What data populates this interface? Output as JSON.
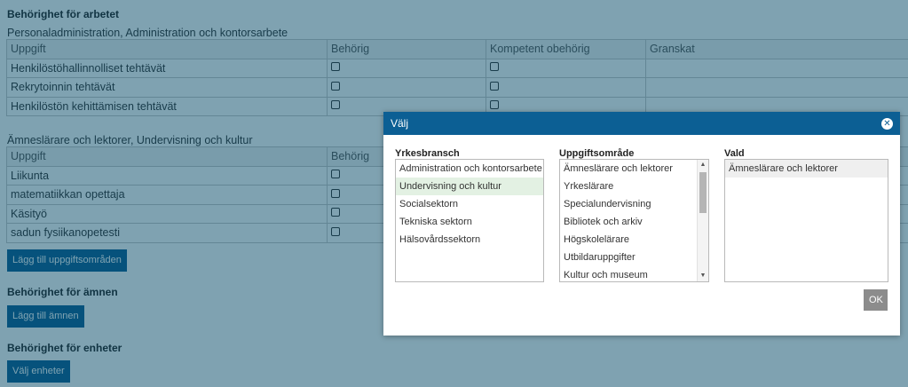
{
  "section1": {
    "heading": "Behörighet för arbetet",
    "subheading": "Personaladministration, Administration och kontorsarbete",
    "columns": [
      "Uppgift",
      "Behörig",
      "Kompetent obehörig",
      "Granskat"
    ],
    "rows": [
      "Henkilöstöhallinnolliset tehtävät",
      "Rekrytoinnin tehtävät",
      "Henkilöstön kehittämisen tehtävät"
    ]
  },
  "section2": {
    "subheading": "Ämneslärare och lektorer, Undervisning och kultur",
    "columns": [
      "Uppgift",
      "Behörig"
    ],
    "rows": [
      "Liikunta",
      "matematiikkan opettaja",
      "Käsityö",
      "sadun fysiikanopetesti"
    ]
  },
  "buttons": {
    "add_task_area": "Lägg till uppgiftsområden",
    "add_subject": "Lägg till ämnen",
    "choose_units": "Välj enheter"
  },
  "headings": {
    "subjects": "Behörighet för ämnen",
    "units": "Behörighet för enheter"
  },
  "dialog": {
    "title": "Välj",
    "ok_label": "OK",
    "close_icon": "close-icon",
    "branch_label": "Yrkesbransch",
    "branches": [
      "Administration och kontorsarbete",
      "Undervisning och kultur",
      "Socialsektorn",
      "Tekniska sektorn",
      "Hälsovårdssektorn"
    ],
    "area_label": "Uppgiftsområde",
    "areas": [
      "Ämneslärare och lektorer",
      "Yrkeslärare",
      "Specialundervisning",
      "Bibliotek och arkiv",
      "Högskolelärare",
      "Utbildaruppgifter",
      "Kultur och museum"
    ],
    "selected_label": "Vald",
    "selected": [
      "Ämneslärare och lektorer"
    ]
  },
  "colors": {
    "primary": "#0c5f94",
    "overlay": "#004664",
    "selected_item": "#e3f1e3"
  }
}
